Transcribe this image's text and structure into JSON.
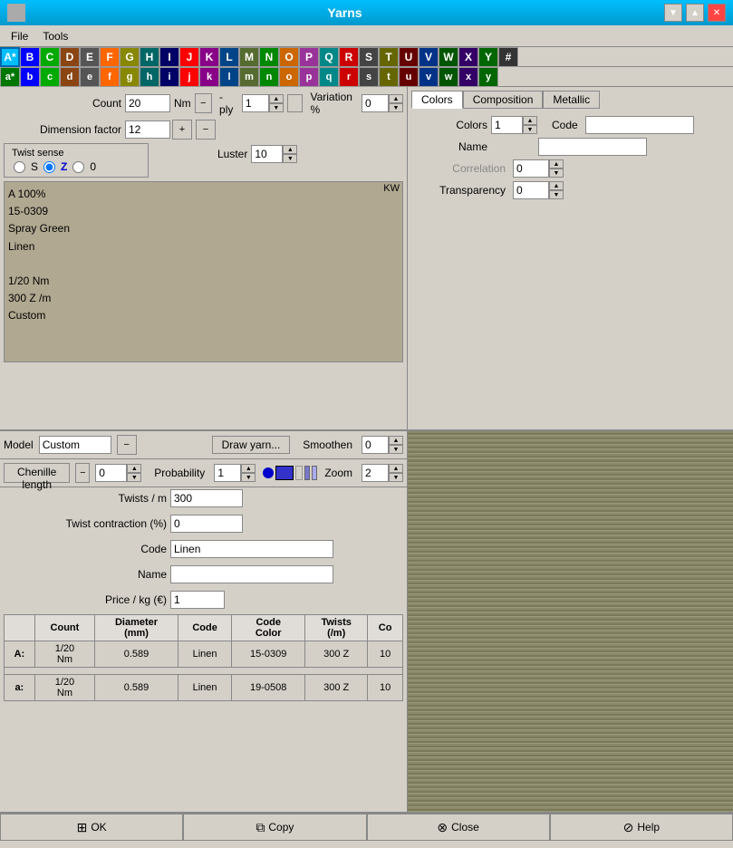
{
  "titleBar": {
    "title": "Yarns",
    "minimizeIcon": "▼",
    "maximizeIcon": "▲",
    "closeIcon": "✕"
  },
  "menuBar": {
    "items": [
      "File",
      "Tools"
    ]
  },
  "upperTabs": [
    "A*",
    "B",
    "C",
    "D",
    "E",
    "F",
    "G",
    "H",
    "I",
    "J",
    "K",
    "L",
    "M",
    "N",
    "O",
    "P",
    "Q",
    "R",
    "S",
    "T",
    "U",
    "V",
    "W",
    "X",
    "Y",
    "#"
  ],
  "lowerTabs": [
    "a*",
    "b",
    "c",
    "d",
    "e",
    "f",
    "g",
    "h",
    "i",
    "j",
    "k",
    "l",
    "m",
    "n",
    "o",
    "p",
    "q",
    "r",
    "s",
    "t",
    "u",
    "v",
    "w",
    "x",
    "y"
  ],
  "topForm": {
    "countLabel": "Count",
    "countValue": "20",
    "nmLabel": "Nm",
    "plyLabel": "-ply",
    "plyValue": "1",
    "variationLabel": "Variation %",
    "variationValue": "0",
    "dimensionLabel": "Dimension factor",
    "dimensionValue": "12",
    "lusterLabel": "Luster",
    "lusterValue": "10"
  },
  "twistSense": {
    "label": "Twist sense",
    "options": [
      "S",
      "Z",
      "0"
    ],
    "selected": "Z"
  },
  "infoText": {
    "line1": "A 100%",
    "line2": "15-0309",
    "line3": "Spray Green",
    "line4": "Linen",
    "line5": "",
    "line6": "1/20 Nm",
    "line7": "300 Z /m",
    "line8": "Custom",
    "kwLabel": "KW"
  },
  "rightPanel": {
    "tabs": [
      "Colors",
      "Composition",
      "Metallic"
    ],
    "colorsTab": {
      "colorsLabel": "Colors",
      "colorsValue": "1",
      "codeLabel": "Code",
      "codeValue": "",
      "nameLabel": "Name",
      "nameValue": "",
      "correlationLabel": "Correlation",
      "correlationValue": "0",
      "transparencyLabel": "Transparency",
      "transparencyValue": "0"
    }
  },
  "bottomLeft": {
    "modelLabel": "Model",
    "modelValue": "Custom",
    "drawYarnLabel": "Draw yarn...",
    "smoothenLabel": "Smoothen",
    "smoothenValue": "0",
    "zoomLabel": "Zoom",
    "zoomValue": "2",
    "chenilleLengthLabel": "Chenille length",
    "chenilleValue": "0",
    "probabilityLabel": "Probability",
    "probabilityValue": "1",
    "twistsLabel": "Twists / m",
    "twistsValue": "300",
    "twistContractionLabel": "Twist contraction (%)",
    "twistContractionValue": "0",
    "codeLabel": "Code",
    "codeValue": "Linen",
    "nameLabel": "Name",
    "nameValue": "",
    "priceLabel": "Price / kg (€)",
    "priceValue": "1"
  },
  "table": {
    "headers": [
      "Count",
      "Diameter\n(mm)",
      "Code",
      "Code\nColor",
      "Twists\n(/m)",
      "Co"
    ],
    "rows": [
      {
        "rowId": "A:",
        "count": "1/20\nNm",
        "diameter": "0.589",
        "code": "Linen",
        "codeColor": "15-0309",
        "twists": "300 Z",
        "co": "10"
      },
      {
        "rowId": "a:",
        "count": "1/20\nNm",
        "diameter": "0.589",
        "code": "Linen",
        "codeColor": "19-0508",
        "twists": "300 Z",
        "co": "10"
      }
    ]
  },
  "footer": {
    "okLabel": "OK",
    "copyLabel": "Copy",
    "closeLabel": "Close",
    "helpLabel": "Help"
  }
}
